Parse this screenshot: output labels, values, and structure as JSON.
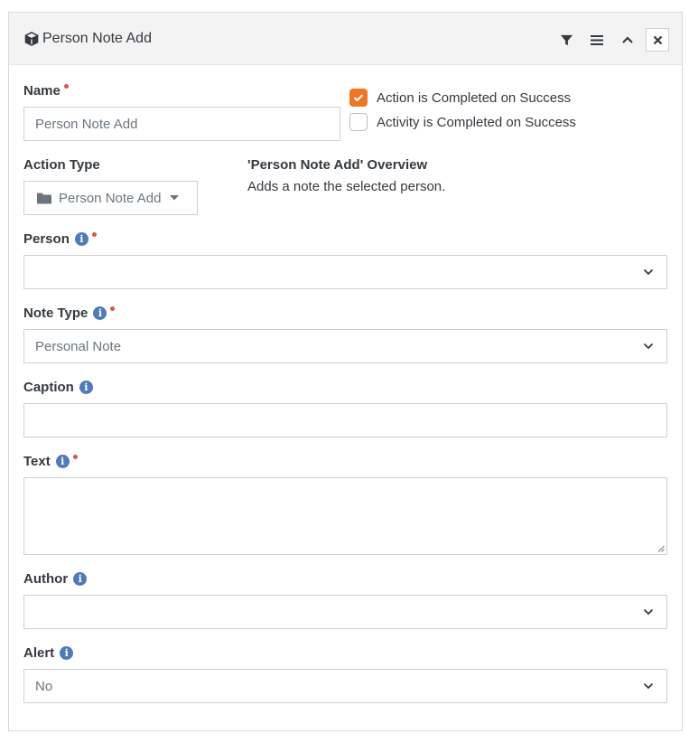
{
  "header": {
    "title": "Person Note Add",
    "icon": "cube-icon",
    "actions": [
      "filter-icon",
      "menu-icon",
      "chevron-up-icon",
      "close-icon"
    ]
  },
  "fields": {
    "name": {
      "label": "Name",
      "value": "Person Note Add",
      "required": true
    },
    "action_completed": {
      "label": "Action is Completed on Success",
      "checked": true
    },
    "activity_completed": {
      "label": "Activity is Completed on Success",
      "checked": false
    },
    "action_type": {
      "label": "Action Type",
      "value": "Person Note Add"
    },
    "overview": {
      "title": "'Person Note Add' Overview",
      "description": "Adds a note the selected person."
    },
    "person": {
      "label": "Person",
      "value": "",
      "required": true
    },
    "note_type": {
      "label": "Note Type",
      "value": "Personal Note",
      "required": true
    },
    "caption": {
      "label": "Caption",
      "value": ""
    },
    "text": {
      "label": "Text",
      "value": "",
      "required": true
    },
    "author": {
      "label": "Author",
      "value": ""
    },
    "alert": {
      "label": "Alert",
      "value": "No"
    }
  },
  "colors": {
    "accent": "#ee7624",
    "required": "#d9534f",
    "info": "#4f7bb6"
  }
}
